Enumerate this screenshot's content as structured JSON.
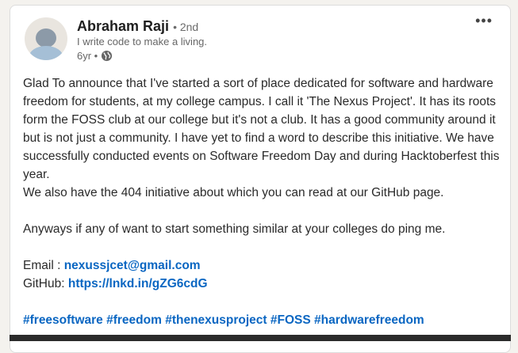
{
  "author": {
    "name": "Abraham Raji",
    "degree": "• 2nd",
    "headline": "I write code to make a living.",
    "time": "6yr •"
  },
  "icons": {
    "globe": "globe-icon",
    "menu": "more-options-icon",
    "avatar": "default-avatar"
  },
  "menu_label": "•••",
  "post": {
    "paragraph1": "Glad To announce that I've started a sort of place dedicated for software and hardware freedom for students, at my college campus. I call it 'The Nexus Project'. It has its roots form the FOSS club at our college but it's not a club. It has a good community around it but is not just a community. I have yet to find a word to describe this initiative. We have successfully conducted events on Software Freedom Day and during Hacktoberfest this year.",
    "paragraph2": "We also have the 404 initiative about which you can read at our GitHub page.",
    "paragraph3": "Anyways if any of want to start something similar at your colleges do ping me.",
    "email_label": "Email : ",
    "email_value": "nexussjcet@gmail.com",
    "github_label": "GitHub: ",
    "github_value": "https://lnkd.in/gZG6cdG",
    "hashtags": [
      "#freesoftware",
      "#freedom",
      "#thenexusproject",
      "#FOSS",
      "#hardwarefreedom"
    ]
  },
  "colors": {
    "link": "#0a66c2",
    "text": "#2a2a2a",
    "muted": "#666666"
  }
}
